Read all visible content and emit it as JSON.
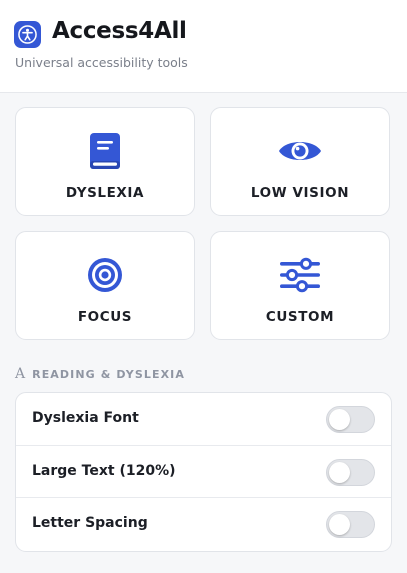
{
  "app": {
    "title": "Access4All",
    "subtitle": "Universal accessibility tools",
    "logo_icon": "accessibility-person-icon",
    "accent_color": "#3457d5"
  },
  "modes": [
    {
      "label": "DYSLEXIA",
      "icon": "book-icon"
    },
    {
      "label": "LOW VISION",
      "icon": "eye-icon"
    },
    {
      "label": "FOCUS",
      "icon": "target-icon"
    },
    {
      "label": "CUSTOM",
      "icon": "sliders-icon"
    }
  ],
  "section": {
    "icon": "A",
    "title": "READING & DYSLEXIA"
  },
  "settings": [
    {
      "label": "Dyslexia Font",
      "enabled": false
    },
    {
      "label": "Large Text (120%)",
      "enabled": false
    },
    {
      "label": "Letter Spacing",
      "enabled": false
    }
  ]
}
